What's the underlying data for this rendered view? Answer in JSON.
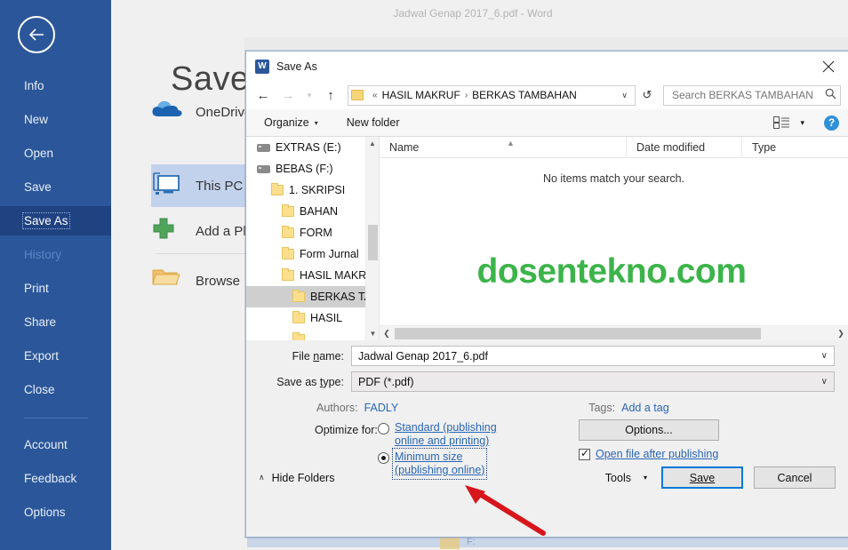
{
  "word": {
    "document_title": "Jadwal Genap 2017_6.pdf  -  Word",
    "back_button": "back-arrow",
    "heading": "Save As",
    "nav_items": [
      {
        "label": "Info",
        "state": "normal"
      },
      {
        "label": "New",
        "state": "normal"
      },
      {
        "label": "Open",
        "state": "normal"
      },
      {
        "label": "Save",
        "state": "normal"
      },
      {
        "label": "Save As",
        "state": "selected"
      },
      {
        "label": "History",
        "state": "disabled"
      },
      {
        "label": "Print",
        "state": "normal"
      },
      {
        "label": "Share",
        "state": "normal"
      },
      {
        "label": "Export",
        "state": "normal"
      },
      {
        "label": "Close",
        "state": "normal"
      },
      {
        "label": "Account",
        "state": "normal"
      },
      {
        "label": "Feedback",
        "state": "normal"
      },
      {
        "label": "Options",
        "state": "normal"
      }
    ],
    "places": [
      {
        "label": "OneDrive",
        "icon": "onedrive-cloud-icon",
        "active": false
      },
      {
        "label": "This PC",
        "icon": "this-pc-monitor-icon",
        "active": true
      },
      {
        "label": "Add a Place",
        "icon": "plus-icon",
        "active": false
      },
      {
        "label": "Browse",
        "icon": "folder-open-icon",
        "active": false
      }
    ],
    "ghost_drive_label": "F:"
  },
  "dialog": {
    "title": "Save As",
    "close_label": "✕",
    "nav": {
      "back": "←",
      "forward": "→",
      "recent": "▾",
      "up": "↑",
      "refresh": "↺",
      "breadcrumb_prefix": "«",
      "breadcrumb": [
        "HASIL MAKRUF",
        "BERKAS TAMBAHAN"
      ],
      "breadcrumb_separator": "›",
      "dropdown_chevron": "∨"
    },
    "search": {
      "placeholder": "Search BERKAS TAMBAHAN",
      "value": "",
      "icon": "search-icon"
    },
    "command_bar": {
      "organize": "Organize",
      "organize_caret": "▾",
      "new_folder": "New folder",
      "view_icon": "view-layout-icon",
      "view_caret": "▾",
      "help_icon": "help-question-icon",
      "help_glyph": "?"
    },
    "tree": [
      {
        "label": "EXTRAS (E:)",
        "icon": "drive-icon",
        "indent": 0,
        "selected": false
      },
      {
        "label": "BEBAS (F:)",
        "icon": "drive-icon",
        "indent": 0,
        "selected": false
      },
      {
        "label": "1. SKRIPSI",
        "icon": "folder-icon",
        "indent": 1,
        "selected": false
      },
      {
        "label": "BAHAN",
        "icon": "folder-icon",
        "indent": 2,
        "selected": false
      },
      {
        "label": "FORM",
        "icon": "folder-icon",
        "indent": 2,
        "selected": false
      },
      {
        "label": "Form Jurnal",
        "icon": "folder-icon",
        "indent": 2,
        "selected": false
      },
      {
        "label": "HASIL MAKRUF",
        "icon": "folder-icon",
        "indent": 2,
        "selected": false
      },
      {
        "label": "BERKAS TAMBAHAN",
        "icon": "folder-icon",
        "indent": 3,
        "selected": true
      },
      {
        "label": "HASIL",
        "icon": "folder-icon",
        "indent": 3,
        "selected": false
      }
    ],
    "columns": [
      "Name",
      "Date modified",
      "Type"
    ],
    "empty_message": "No items match your search.",
    "watermark": "dosentekno.com",
    "watermark_color": "#3cb44a",
    "file_name": {
      "label": "File name:",
      "label_prefix": "File ",
      "label_accel": "n",
      "label_suffix": "ame:",
      "value": "Jadwal Genap 2017_6.pdf"
    },
    "save_as_type": {
      "label": "Save as type:",
      "label_prefix": "Save as ",
      "label_accel": "t",
      "label_suffix": "ype:",
      "value": "PDF (*.pdf)"
    },
    "authors": {
      "label": "Authors:",
      "value": "FADLY"
    },
    "tags": {
      "label": "Tags:",
      "value": "Add a tag"
    },
    "optimize": {
      "label": "Optimize for:",
      "standard": {
        "line1": "Standard (publishing",
        "line2": "online and printing)",
        "selected": false
      },
      "minimum": {
        "line1": "Minimum size",
        "line2": "(publishing online)",
        "selected": true
      }
    },
    "options_button": "Options...",
    "open_after_publishing": {
      "label": "Open file after publishing",
      "checked": true
    },
    "hide_folders": {
      "label": "Hide Folders",
      "caret": "∧"
    },
    "tools_button": {
      "label": "Tools",
      "caret": "▾"
    },
    "save_button": "Save",
    "cancel_button": "Cancel"
  },
  "annotation": {
    "arrow_color": "#d7161b",
    "name": "red-pointer-arrow"
  }
}
